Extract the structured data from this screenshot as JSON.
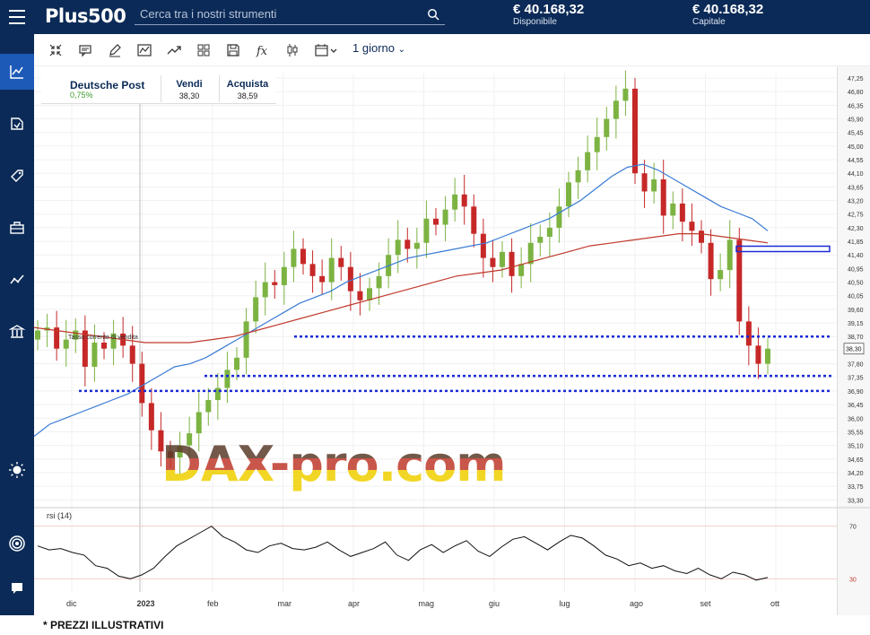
{
  "header": {
    "logo": "Plus500",
    "search_placeholder": "Cerca tra i nostri strumenti",
    "available_value": "€ 40.168,32",
    "available_label": "Disponibile",
    "capital_value": "€ 40.168,32",
    "capital_label": "Capitale"
  },
  "sidebar": {
    "items": [
      {
        "icon": "chart-line-icon",
        "active": true
      },
      {
        "icon": "trade-arrows-icon"
      },
      {
        "icon": "tag-icon"
      },
      {
        "icon": "briefcase-icon"
      },
      {
        "icon": "trend-icon"
      },
      {
        "icon": "bank-icon"
      },
      {
        "icon": "sun-icon"
      },
      {
        "icon": "target-icon"
      },
      {
        "icon": "chat-icon"
      }
    ]
  },
  "toolbar": {
    "icons": [
      "collapse-arrows-icon",
      "chat-box-icon",
      "pencil-icon",
      "line-chart-icon",
      "trend-up-icon",
      "grid-icon",
      "save-icon",
      "fx-icon",
      "candles-icon",
      "calendar-icon"
    ],
    "timeframe": "1 giorno"
  },
  "instrument": {
    "name": "Deutsche Post",
    "change": "0,75%",
    "sell_label": "Vendi",
    "sell_value": "38,30",
    "buy_label": "Acquista",
    "buy_value": "38,59",
    "current_price_tag": "38,30",
    "current_sell_rate_label": "Tasso corrente di vendita"
  },
  "chart_data": {
    "type": "candlestick",
    "price_axis_ticks": [
      "47,25",
      "46,80",
      "46,35",
      "45,90",
      "45,45",
      "45,00",
      "44,55",
      "44,10",
      "43,65",
      "43,20",
      "42,75",
      "42,30",
      "41,85",
      "41,40",
      "40,95",
      "40,50",
      "40,05",
      "39,60",
      "39,15",
      "38,70",
      "38,25",
      "37,80",
      "37,35",
      "36,90",
      "36,45",
      "36,00",
      "35,55",
      "35,10",
      "34,65",
      "34,20",
      "33,75",
      "33,30"
    ],
    "month_ticks": [
      "dic",
      "2023",
      "feb",
      "mar",
      "apr",
      "mag",
      "giu",
      "lug",
      "ago",
      "set",
      "ott"
    ],
    "y_range": [
      33.1,
      47.4
    ],
    "series": [
      {
        "name": "close",
        "color": "#1a1a1a",
        "values": [
          38.9,
          39.0,
          38.3,
          38.6,
          38.9,
          37.7,
          38.5,
          38.3,
          38.8,
          38.4,
          37.8,
          36.5,
          35.6,
          34.9,
          34.7,
          35.1,
          35.5,
          36.2,
          36.6,
          37.0,
          37.6,
          38.0,
          39.2,
          40.0,
          40.5,
          40.4,
          41.0,
          41.6,
          41.1,
          40.7,
          40.5,
          41.3,
          41.0,
          40.2,
          39.9,
          40.3,
          40.7,
          41.4,
          41.9,
          41.6,
          41.8,
          42.6,
          42.4,
          42.9,
          43.4,
          43.0,
          42.1,
          41.3,
          41.0,
          41.5,
          40.7,
          41.1,
          41.8,
          42.0,
          42.3,
          43.0,
          43.8,
          44.2,
          44.8,
          45.3,
          45.9,
          46.5,
          46.9,
          44.1,
          43.5,
          43.9,
          42.7,
          43.1,
          42.5,
          42.2,
          41.8,
          40.6,
          40.9,
          41.9,
          39.2,
          38.4,
          37.8,
          38.3
        ]
      },
      {
        "name": "sma-50",
        "color": "#3a7bd5",
        "values": [
          35.4,
          35.8,
          36.0,
          36.2,
          36.4,
          36.6,
          36.8,
          37.1,
          37.4,
          37.7,
          37.8,
          38.0,
          38.3,
          38.6,
          38.9,
          39.2,
          39.5,
          39.8,
          40.0,
          40.2,
          40.5,
          40.7,
          40.9,
          41.1,
          41.3,
          41.4,
          41.5,
          41.6,
          41.7,
          41.8,
          42.0,
          42.2,
          42.4,
          42.6,
          42.9,
          43.2,
          43.6,
          44.0,
          44.3,
          44.4,
          44.2,
          43.9,
          43.6,
          43.3,
          43.0,
          42.8,
          42.6,
          42.2
        ]
      },
      {
        "name": "sma-200",
        "color": "#c0392b",
        "values": [
          39.0,
          38.9,
          38.8,
          38.7,
          38.6,
          38.5,
          38.5,
          38.5,
          38.6,
          38.7,
          38.9,
          39.1,
          39.3,
          39.5,
          39.7,
          39.9,
          40.1,
          40.3,
          40.5,
          40.7,
          40.8,
          40.9,
          41.1,
          41.3,
          41.5,
          41.7,
          41.8,
          41.9,
          42.0,
          42.1,
          42.1,
          42.0,
          41.9,
          41.8
        ]
      }
    ],
    "support_levels": [
      38.7,
      37.4,
      36.9
    ],
    "resistance_box": 41.6,
    "rsi": {
      "label": "rsi (14)",
      "levels": [
        "70",
        "30"
      ],
      "values": [
        55,
        52,
        53,
        50,
        48,
        40,
        38,
        32,
        30,
        33,
        38,
        47,
        55,
        60,
        65,
        70,
        62,
        58,
        52,
        50,
        55,
        57,
        53,
        52,
        54,
        58,
        52,
        47,
        50,
        53,
        58,
        48,
        44,
        52,
        56,
        50,
        55,
        59,
        51,
        47,
        54,
        60,
        62,
        57,
        52,
        58,
        63,
        61,
        55,
        48,
        45,
        40,
        42,
        38,
        40,
        36,
        34,
        38,
        33,
        30,
        35,
        33,
        29,
        31
      ]
    }
  },
  "watermark": "DAX-pro.com",
  "footer_note": "* PREZZI ILLUSTRATIVI"
}
